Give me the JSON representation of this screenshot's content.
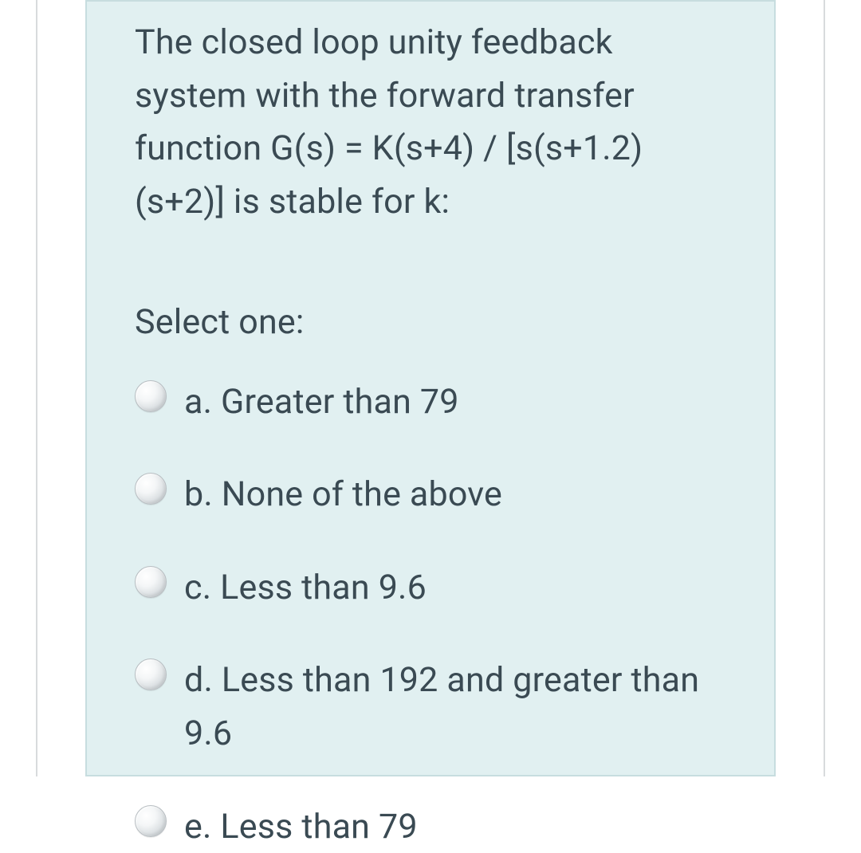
{
  "question": {
    "text": "The closed loop unity feedback system with the forward transfer function G(s) = K(s+4) / [s(s+1.2)(s+2)] is stable for k:",
    "prompt": "Select one:",
    "options": [
      {
        "letter": "a.",
        "label": "Greater than 79"
      },
      {
        "letter": "b.",
        "label": "None of the above"
      },
      {
        "letter": "c.",
        "label": "Less than 9.6"
      },
      {
        "letter": "d.",
        "label": "Less than 192 and greater than 9.6"
      },
      {
        "letter": "e.",
        "label": "Less than 79"
      }
    ]
  }
}
